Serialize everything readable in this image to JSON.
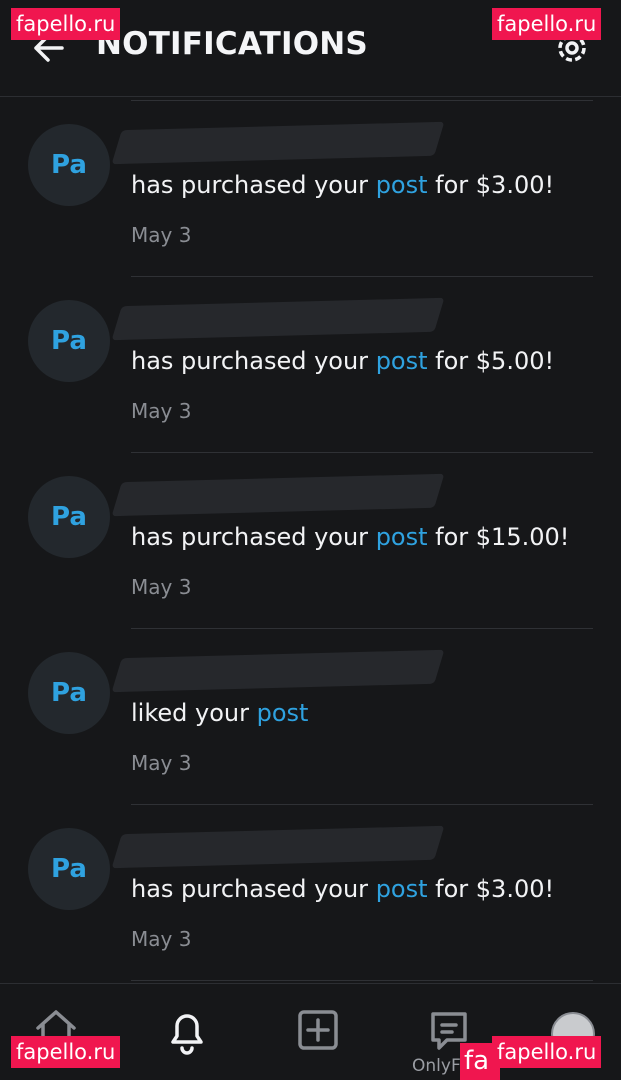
{
  "header": {
    "title": "NOTIFICATIONS",
    "back_icon": "arrow-left-icon",
    "settings_icon": "gear-icon"
  },
  "notifications": [
    {
      "avatar_initials": "Pa",
      "action_text": "has purchased your ",
      "link_text": "post",
      "amount_text": " for $3.00!",
      "date": "May 3"
    },
    {
      "avatar_initials": "Pa",
      "action_text": "has purchased your ",
      "link_text": "post",
      "amount_text": " for $5.00!",
      "date": "May 3"
    },
    {
      "avatar_initials": "Pa",
      "action_text": "has purchased your ",
      "link_text": "post",
      "amount_text": " for $15.00!",
      "date": "May 3"
    },
    {
      "avatar_initials": "Pa",
      "action_text": "liked your ",
      "link_text": "post",
      "amount_text": "",
      "date": "May 3"
    },
    {
      "avatar_initials": "Pa",
      "action_text": "has purchased your ",
      "link_text": "post",
      "amount_text": " for $3.00!",
      "date": "May 3"
    }
  ],
  "bottom_nav": {
    "items": [
      "home-icon",
      "bell-icon",
      "add-post-icon",
      "messages-icon",
      "profile-avatar"
    ],
    "brand_text": "OnlyF"
  },
  "watermarks": {
    "top_left": "fapello.ru",
    "top_right": "fapello.ru",
    "bottom_left": "fapello.ru",
    "bottom_right": "fapello.ru",
    "fragment": "fa"
  },
  "colors": {
    "background": "#161719",
    "accent": "#2fa2e0",
    "muted_text": "#8a8d93",
    "watermark": "#f0164f"
  }
}
